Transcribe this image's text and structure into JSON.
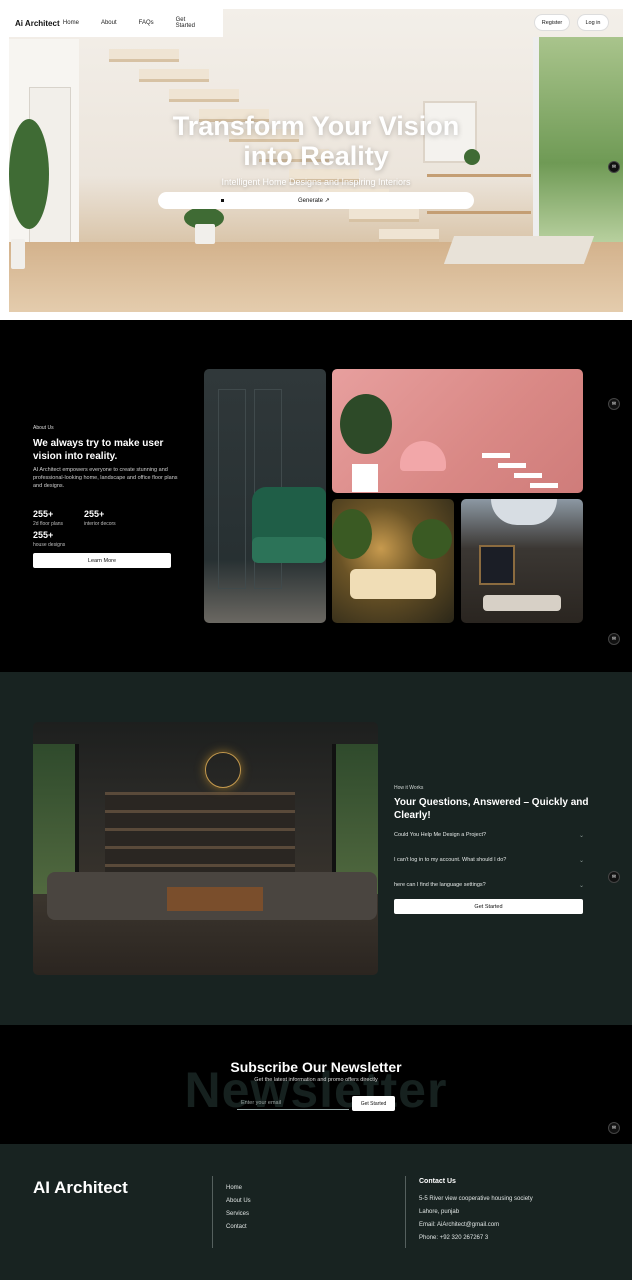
{
  "header": {
    "brand": "Ai Architect",
    "nav": [
      "Home",
      "About",
      "FAQs",
      "Get Started"
    ],
    "register": "Register",
    "login": "Log in"
  },
  "hero": {
    "title_line1": "Transform Your Vision",
    "title_line2": "into Reality",
    "subtitle": "Intelligent Home Designs and Inspiring Interiors",
    "generate_label": "Generate ↗"
  },
  "about": {
    "eyebrow": "About Us",
    "heading": "We always try to make user vision into reality.",
    "description": "AI Architect empowers everyone to create stunning and professional-looking home, landscape and office floor plans and designs.",
    "stats": [
      {
        "value": "255+",
        "label": "2d floor plans"
      },
      {
        "value": "255+",
        "label": "interior decors"
      },
      {
        "value": "255+",
        "label": "house designs"
      }
    ],
    "learn_more": "Learn More"
  },
  "faq": {
    "eyebrow": "How it Works",
    "heading": "Your Questions, Answered – Quickly and Clearly!",
    "questions": [
      "Could You Help Me Design a Project?",
      "I can't log in to my account. What should I do?",
      "here can I find the language settings?"
    ],
    "cta": "Get Started"
  },
  "newsletter": {
    "ghost_text": "Newsletter",
    "title": "Subscribe Our Newsletter",
    "subtitle": "Get the latest information and promo offers directly",
    "placeholder": "Enter your email",
    "button": "Get Started"
  },
  "footer": {
    "brand": "AI Architect",
    "links": [
      "Home",
      "About Us",
      "Services",
      "Contact"
    ],
    "contact_heading": "Contact Us",
    "contact_lines": [
      "5-5 River view cooperative housing society",
      "Lahore, punjab",
      "Email: AiArchitect@gmail.com",
      "Phone: +92 320 267267 3"
    ]
  },
  "icons": {
    "chat": "chat-icon",
    "chevron": "chevron-down-icon"
  },
  "colors": {
    "dark_teal": "#182321",
    "black": "#000000",
    "white": "#ffffff"
  }
}
